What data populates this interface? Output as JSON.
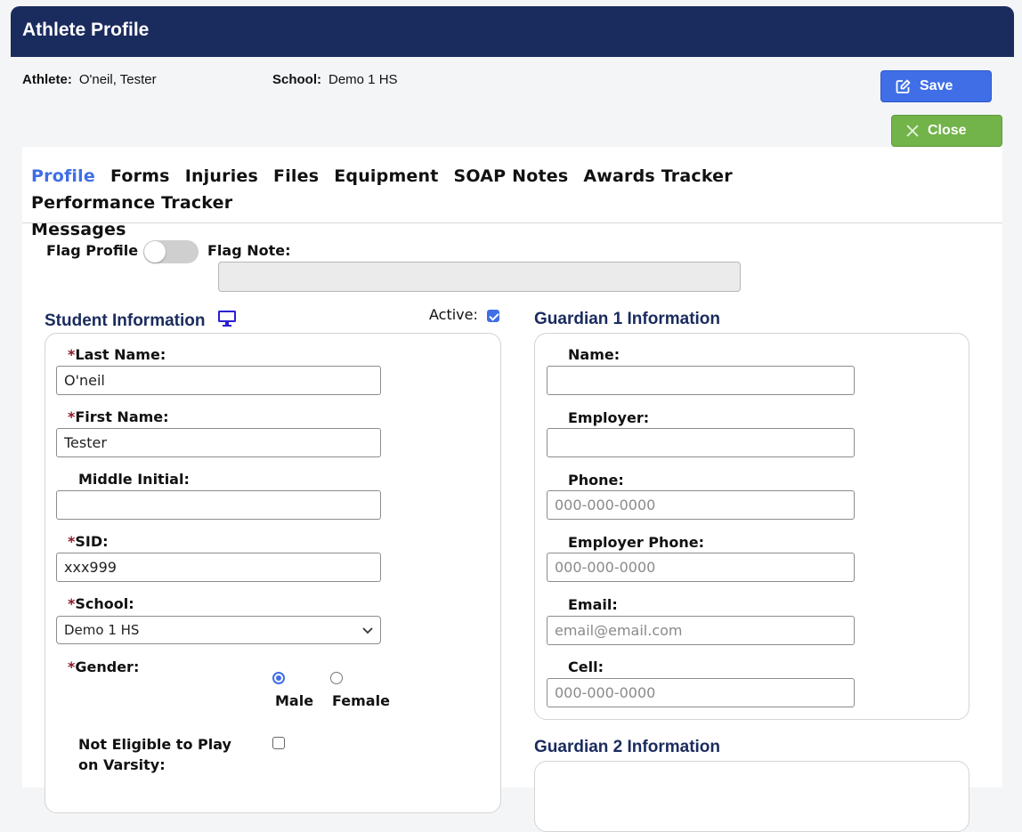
{
  "header": {
    "title": "Athlete Profile"
  },
  "meta": {
    "athlete_label": "Athlete:",
    "athlete_value": "O'neil, Tester",
    "school_label": "School:",
    "school_value": "Demo 1 HS"
  },
  "buttons": {
    "save": "Save",
    "close": "Close"
  },
  "tabs": [
    {
      "label": "Profile",
      "active": true
    },
    {
      "label": "Forms"
    },
    {
      "label": "Injuries"
    },
    {
      "label": "Files"
    },
    {
      "label": "Equipment"
    },
    {
      "label": "SOAP Notes"
    },
    {
      "label": "Awards Tracker"
    },
    {
      "label": "Performance Tracker"
    },
    {
      "label": "Messages"
    }
  ],
  "flag": {
    "profile_label": "Flag Profile",
    "profile_on": false,
    "note_label": "Flag Note:",
    "note_value": ""
  },
  "student": {
    "title": "Student Information",
    "active_label": "Active:",
    "active_checked": true,
    "last_name_label": "Last Name:",
    "last_name_value": "O'neil",
    "first_name_label": "First Name:",
    "first_name_value": "Tester",
    "middle_label": "Middle Initial:",
    "middle_value": "",
    "sid_label": "SID:",
    "sid_value": "xxx999",
    "school_label": "School:",
    "school_value": "Demo 1 HS",
    "gender_label": "Gender:",
    "gender_male": "Male",
    "gender_female": "Female",
    "gender_selected": "Male",
    "varsity_label_line1": "Not Eligible to Play",
    "varsity_label_line2": "on Varsity:",
    "varsity_checked": false,
    "required_mark": "*"
  },
  "guardian1": {
    "title": "Guardian 1 Information",
    "name_label": "Name:",
    "employer_label": "Employer:",
    "phone_label": "Phone:",
    "phone_placeholder": "000-000-0000",
    "employer_phone_label": "Employer Phone:",
    "employer_phone_placeholder": "000-000-0000",
    "email_label": "Email:",
    "email_placeholder": "email@email.com",
    "cell_label": "Cell:",
    "cell_placeholder": "000-000-0000"
  },
  "guardian2": {
    "title": "Guardian 2 Information"
  },
  "colors": {
    "navy": "#1a2b5e",
    "primary": "#3f6ee6",
    "success": "#72b34a",
    "required": "#8b1a2a"
  },
  "icons": {
    "save": "edit-icon",
    "close": "x-icon",
    "student": "monitor-icon",
    "select": "chevron-down-icon"
  }
}
